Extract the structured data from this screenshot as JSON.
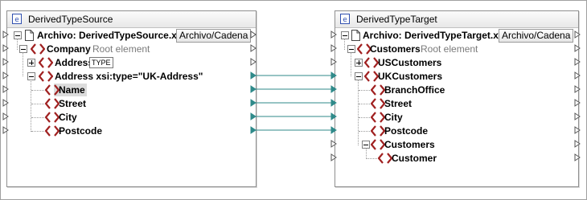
{
  "source": {
    "title": "DerivedTypeSource",
    "file_label": "Archivo: DerivedTypeSource.xml",
    "file_button": "Archivo/Cadena",
    "company": "Company",
    "company_hint": "Root element",
    "address": "Address",
    "address_type_badge": "TYPE",
    "address_derived": "Address xsi:type=\"UK-Address\"",
    "name": "Name",
    "street": "Street",
    "city": "City",
    "postcode": "Postcode"
  },
  "target": {
    "title": "DerivedTypeTarget",
    "file_label": "Archivo: DerivedTypeTarget.xml",
    "file_button": "Archivo/Cadena",
    "customers": "Customers",
    "customers_hint": "Root element",
    "us_customers": "USCustomers",
    "uk_customers": "UKCustomers",
    "branch_office": "BranchOffice",
    "street": "Street",
    "city": "City",
    "postcode": "Postcode",
    "customers_child": "Customers",
    "customer": "Customer"
  },
  "colors": {
    "connection": "#2f8a8a",
    "element_icon": "#a02020",
    "component_icon": "#3050b0"
  }
}
